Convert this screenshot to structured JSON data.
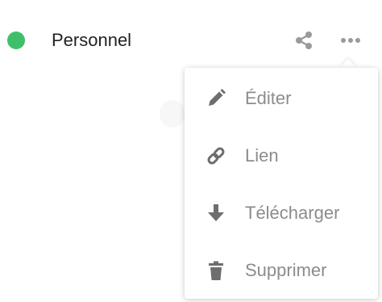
{
  "entry": {
    "label": "Personnel",
    "status_color": "#3fbf6a"
  },
  "actions": {
    "share_icon": "share-icon",
    "more_icon": "more-horizontal-icon"
  },
  "menu": {
    "items": [
      {
        "label": "Éditer",
        "icon": "pencil-icon"
      },
      {
        "label": "Lien",
        "icon": "link-icon"
      },
      {
        "label": "Télécharger",
        "icon": "download-icon"
      },
      {
        "label": "Supprimer",
        "icon": "trash-icon"
      }
    ]
  }
}
